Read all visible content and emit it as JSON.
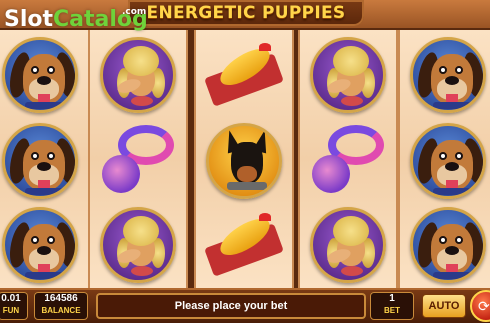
{
  "header": {
    "title": "ENERGETIC PUPPIES",
    "watermark": {
      "slot": "Slot",
      "catalog": "Catalog",
      "com": ".com"
    }
  },
  "reels": [
    {
      "symbols": [
        "basset-hound",
        "basset-hound",
        "basset-hound"
      ]
    },
    {
      "symbols": [
        "poodle",
        "rope-toy",
        "poodle"
      ]
    },
    {
      "symbols": [
        "rubber-chicken",
        "doberman",
        "rubber-chicken"
      ]
    },
    {
      "symbols": [
        "poodle",
        "rope-toy",
        "poodle"
      ]
    },
    {
      "symbols": [
        "basset-hound",
        "basset-hound",
        "basset-hound"
      ]
    }
  ],
  "controls": {
    "fun_value": "0.01",
    "fun_label": "FUN",
    "balance_value": "164586",
    "balance_label": "BALANCE",
    "message": "Please place your bet",
    "bet_value": "1",
    "bet_label": "BET",
    "auto_label": "AUTO",
    "spin_icon": "spin-arrow-icon"
  },
  "colors": {
    "title_gold": "#ffd54a",
    "reel_bg": "#fbe2c4",
    "frame_brown": "#7a3a14",
    "watermark_green": "#6fd23a"
  }
}
